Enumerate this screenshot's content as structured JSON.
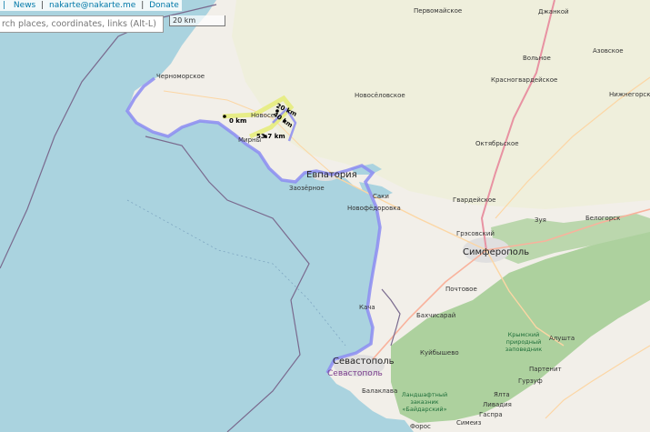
{
  "topbar": {
    "links": [
      "News",
      "nakarte@nakarte.me",
      "Donate"
    ]
  },
  "search": {
    "placeholder": "rch places, coordinates, links (Alt-L)"
  },
  "scale": {
    "label": "20 km"
  },
  "distance_labels": [
    "0 km",
    "20 km",
    "40 km",
    "53.7 km"
  ],
  "places": {
    "pervomayskoe": "Первомайское",
    "dzhankoy": "Джанкой",
    "azovskoe": "Азовское",
    "volnoe": "Вольное",
    "krasnogvardeyskoe": "Красногвардейское",
    "nizhnegorsky": "Нижнегорский",
    "chernomorskoe": "Черноморское",
    "novoselovskoe": "Новосёловское",
    "novoselovka": "Новосе",
    "oktyabrskoe": "Октябрьское",
    "mirny": "Мирны",
    "evpatoria": "Евпатория",
    "zaozernoe": "Заозёрное",
    "saki": "Саки",
    "novofedorovka": "Новофёдоровка",
    "gvardeyskoe": "Гвардейское",
    "zuya": "Зуя",
    "belogorsk": "Белогорск",
    "grestovsky": "Грэсовский",
    "simferopol": "Симферополь",
    "pochtovoe": "Почтовое",
    "kacha": "Кача",
    "bakhchisaray": "Бахчисарай",
    "alushta": "Алушта",
    "kuybyshevo": "Куйбышево",
    "sevastopol": "Севастополь",
    "partenit": "Партенит",
    "gurzuf": "Гурзуф",
    "balaklava": "Балаклава",
    "yalta": "Ялта",
    "livadia": "Ливадия",
    "gaspra": "Гаспра",
    "simeiz": "Симеиз",
    "foros": "Форос"
  },
  "reserves": {
    "crimean": "Крымский природный заповедник",
    "baydar": "Ландшафтный заказник «Байдарский»"
  },
  "colors": {
    "sea": "#aad3df",
    "land": "#f2efe9",
    "farmland": "#eef0d5",
    "forest": "#add19e",
    "city": "#e0dfdf",
    "route": "#8c8cf2",
    "route_highlight": "#e6ec7c",
    "border": "#7a6a8e"
  },
  "icons": [
    "link-icon"
  ]
}
